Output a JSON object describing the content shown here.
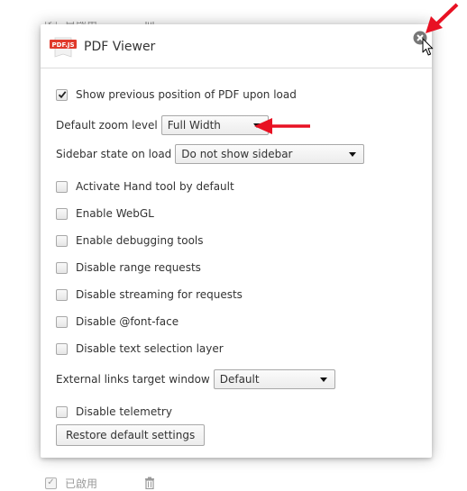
{
  "background": {
    "rows": [
      {
        "label": "已啟用"
      },
      {
        "label": "已啟用"
      }
    ]
  },
  "dialog": {
    "title": "PDF Viewer",
    "logo_text": "PDF.JS",
    "options": {
      "show_previous_position": {
        "label": "Show previous position of PDF upon load",
        "checked": true
      },
      "default_zoom": {
        "label": "Default zoom level",
        "value": "Full Width"
      },
      "sidebar_state": {
        "label": "Sidebar state on load",
        "value": "Do not show sidebar"
      },
      "hand_tool": {
        "label": "Activate Hand tool by default",
        "checked": false
      },
      "webgl": {
        "label": "Enable WebGL",
        "checked": false
      },
      "debugging": {
        "label": "Enable debugging tools",
        "checked": false
      },
      "range_requests": {
        "label": "Disable range requests",
        "checked": false
      },
      "streaming": {
        "label": "Disable streaming for requests",
        "checked": false
      },
      "font_face": {
        "label": "Disable @font-face",
        "checked": false
      },
      "text_selection": {
        "label": "Disable text selection layer",
        "checked": false
      },
      "external_links": {
        "label": "External links target window",
        "value": "Default"
      },
      "telemetry": {
        "label": "Disable telemetry",
        "checked": false
      }
    },
    "restore_button": "Restore default settings"
  },
  "colors": {
    "annotation_arrow": "#e81123",
    "logo_red": "#e0392b",
    "close_icon": "#777777"
  },
  "icons": [
    "pdfjs-logo-icon",
    "close-icon",
    "checkmark-icon",
    "dropdown-caret-icon",
    "trash-icon",
    "mouse-cursor-icon",
    "red-arrow-annotation"
  ]
}
